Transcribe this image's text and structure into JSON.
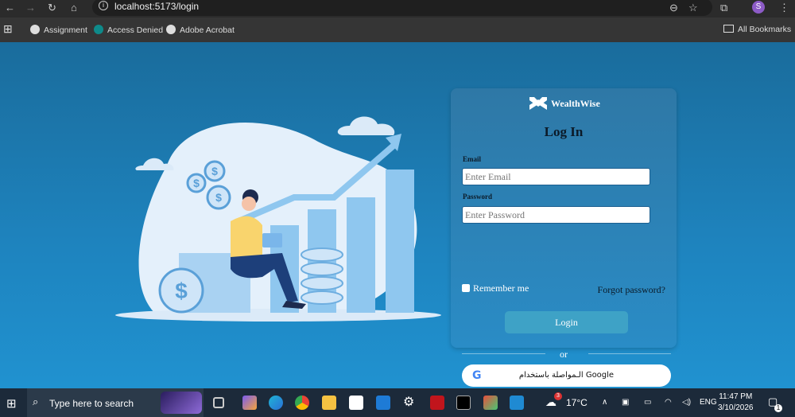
{
  "browser": {
    "url": "localhost:5173/login",
    "profile_initial": "S",
    "bookmarks": [
      "Assignment",
      "Access Denied",
      "Adobe Acrobat"
    ],
    "all_bookmarks": "All Bookmarks"
  },
  "card": {
    "brand": "WealthWise",
    "title": "Log In",
    "email_label": "Email",
    "email_placeholder": "Enter Email",
    "password_label": "Password",
    "password_placeholder": "Enter Password",
    "remember": "Remember me",
    "forgot": "Forgot password?",
    "login_button": "Login",
    "or": "or",
    "google_button": "الـمواصلة باستخدام Google",
    "google_icon": "G"
  },
  "taskbar": {
    "search_placeholder": "Type here to search",
    "weather": "17°C",
    "weather_badge": "3",
    "lang": "ENG",
    "time": "11:47 PM",
    "date": "3/10/2026",
    "notif_count": "1"
  },
  "colors": {
    "accent": "#3ea2c6",
    "bg": "#1e84bf"
  }
}
